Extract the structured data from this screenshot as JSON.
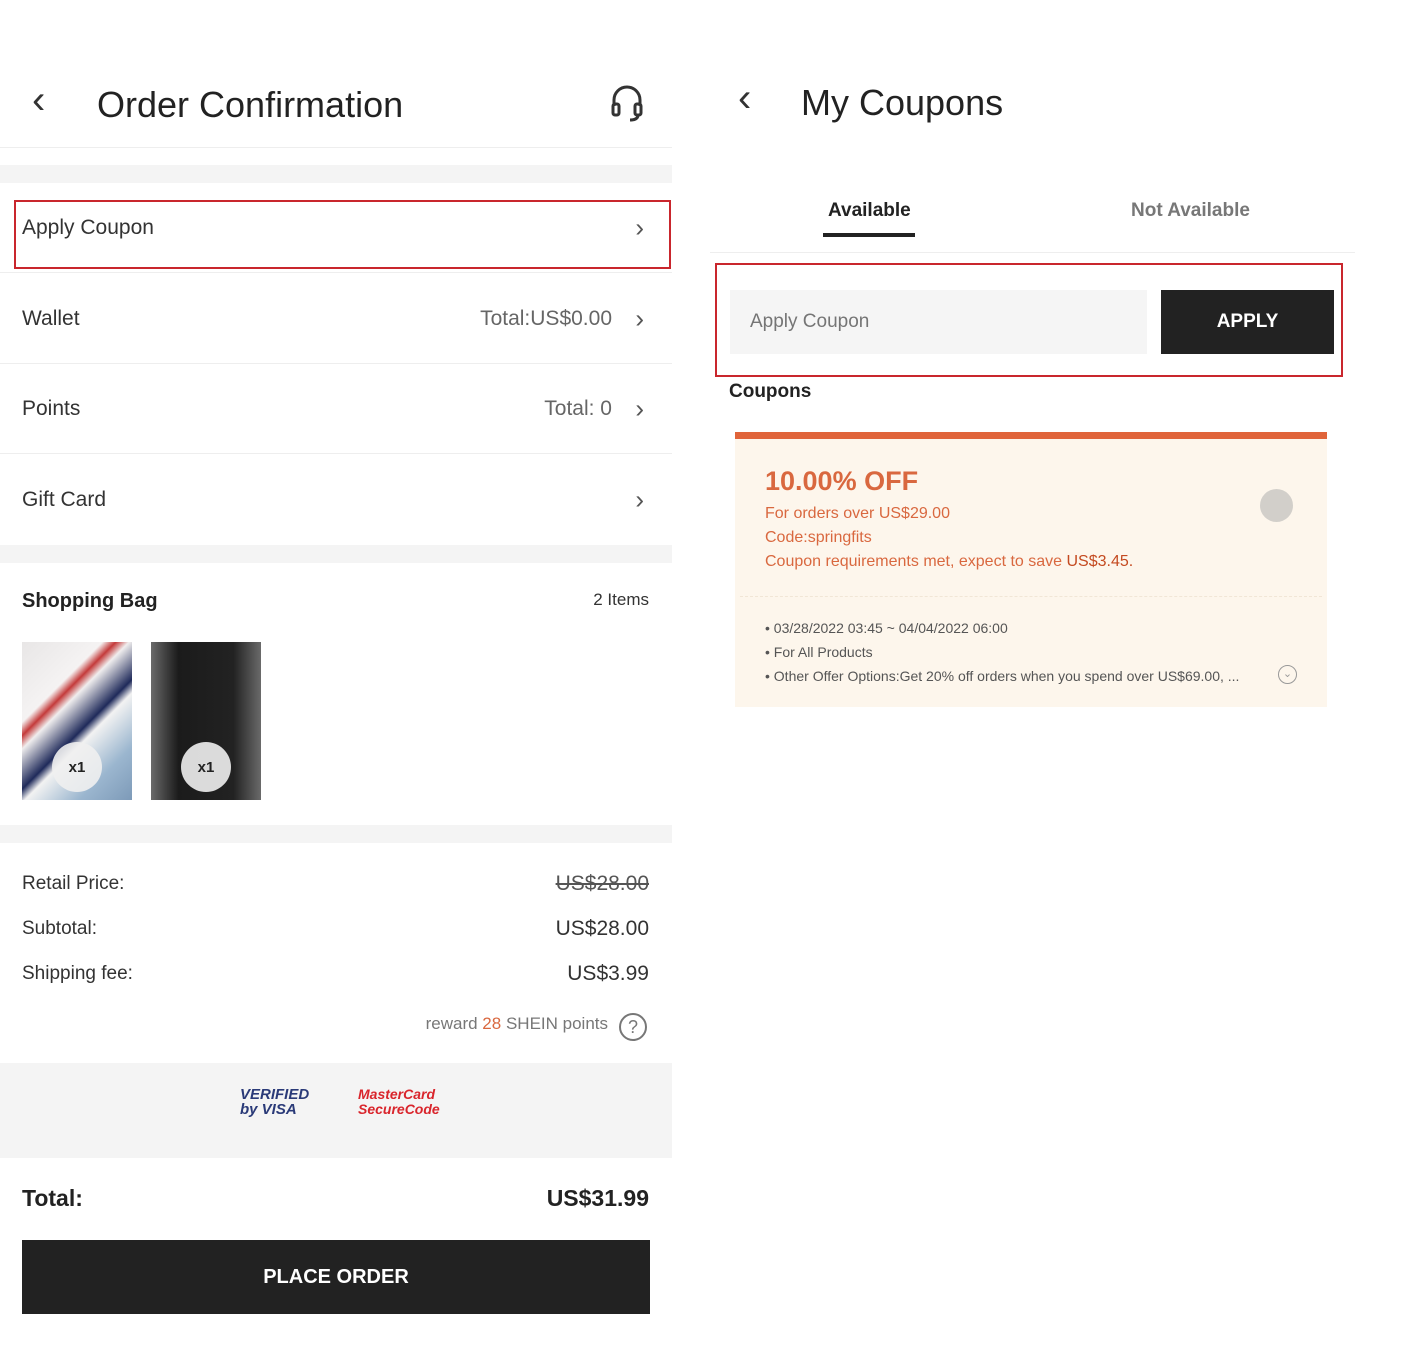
{
  "left": {
    "header": {
      "title": "Order Confirmation"
    },
    "rows": [
      {
        "label": "Apply Coupon",
        "value": ""
      },
      {
        "label": "Wallet",
        "value": "Total:US$0.00"
      },
      {
        "label": "Points",
        "value": "Total: 0"
      },
      {
        "label": "Gift Card",
        "value": ""
      }
    ],
    "bag": {
      "title": "Shopping Bag",
      "count": "2 Items",
      "items": [
        {
          "qty": "x1"
        },
        {
          "qty": "x1"
        }
      ]
    },
    "prices": {
      "retail_label": "Retail Price:",
      "retail": "US$28.00",
      "subtotal_label": "Subtotal:",
      "subtotal": "US$28.00",
      "shipping_label": "Shipping fee:",
      "shipping": "US$3.99",
      "reward_pre": "reward",
      "reward_points": "28",
      "reward_post": "SHEIN points"
    },
    "badges": {
      "visa": "VERIFIED by VISA",
      "mastercard": "MasterCard SecureCode"
    },
    "total_label": "Total:",
    "total": "US$31.99",
    "place_order": "PLACE ORDER"
  },
  "right": {
    "header": {
      "title": "My Coupons"
    },
    "tabs": [
      {
        "label": "Available",
        "active": true
      },
      {
        "label": "Not Available",
        "active": false
      }
    ],
    "input": {
      "placeholder": "Apply Coupon",
      "value": ""
    },
    "apply": "APPLY",
    "section": "Coupons",
    "coupon": {
      "discount": "10.00% OFF",
      "min": "For orders over US$29.00",
      "code": "Code:springfits",
      "note": "Coupon requirements met, expect to save",
      "save": "US$3.45.",
      "details": [
        "03/28/2022  03:45 ~ 04/04/2022  06:00",
        "For All Products",
        "Other Offer Options:Get 20% off orders when you spend over US$69.00, ..."
      ]
    }
  },
  "colors": {
    "accent": "#e0643a",
    "highlight": "#c9262d",
    "dark": "#222222"
  }
}
